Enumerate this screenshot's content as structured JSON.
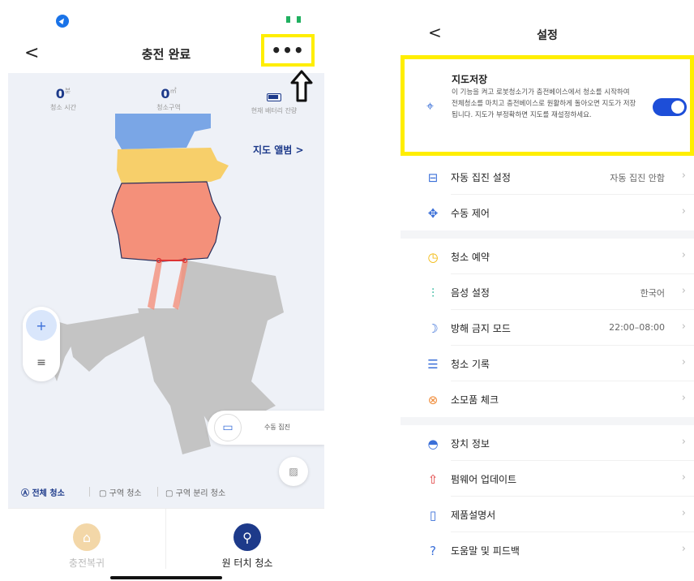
{
  "left": {
    "header": {
      "back": "<",
      "title": "충전 완료",
      "more": "•••"
    },
    "stats": [
      {
        "value": "0",
        "unit": "분",
        "label": "청소 시간"
      },
      {
        "value": "0",
        "unit": "㎡",
        "label": "청소구역"
      },
      {
        "value": "",
        "unit": "",
        "label": "현재 배터리 잔량"
      }
    ],
    "album_link": "지도 앨범 >",
    "manual_collect": "수동 집진",
    "modes": [
      "전체 청소",
      "구역 청소",
      "구역 분리 청소"
    ],
    "bottom": {
      "return_label": "충전복귀",
      "one_touch_label": "원 터치 청소"
    }
  },
  "right": {
    "header": {
      "back": "<",
      "title": "설정"
    },
    "map_save": {
      "title": "지도저장",
      "description": "이 기능을 켜고 로봇청소기가 충전베이스에서 청소를 시작하여 전체청소를 마치고 충전베이스로 원활하게 돌아오면 지도가 저장됩니다. 지도가 부정확하면 지도를 재설정하세요.",
      "enabled": true
    },
    "items": [
      {
        "label": "자동 집진 설정",
        "value": "자동 집진 안함",
        "icon": "dust-bin-icon"
      },
      {
        "label": "수동 제어",
        "value": "",
        "icon": "dpad-icon"
      },
      {
        "label": "청소 예약",
        "value": "",
        "icon": "clock-icon"
      },
      {
        "label": "음성 설정",
        "value": "한국어",
        "icon": "voice-icon"
      },
      {
        "label": "방해 금지 모드",
        "value": "22:00–08:00",
        "icon": "moon-icon"
      },
      {
        "label": "청소 기록",
        "value": "",
        "icon": "record-icon"
      },
      {
        "label": "소모품 체크",
        "value": "",
        "icon": "consumable-icon"
      },
      {
        "label": "장치 정보",
        "value": "",
        "icon": "robot-icon"
      },
      {
        "label": "펌웨어 업데이트",
        "value": "",
        "icon": "update-icon"
      },
      {
        "label": "제품설명서",
        "value": "",
        "icon": "manual-icon"
      },
      {
        "label": "도움말 및 피드백",
        "value": "",
        "icon": "help-icon"
      }
    ]
  },
  "colors": {
    "accent": "#1d4ed8",
    "highlight": "#ffee00",
    "map_blue": "#7aa6e6",
    "map_yellow": "#f7cf6a",
    "map_salmon": "#f4907a",
    "map_gray": "#c4c4c4"
  }
}
